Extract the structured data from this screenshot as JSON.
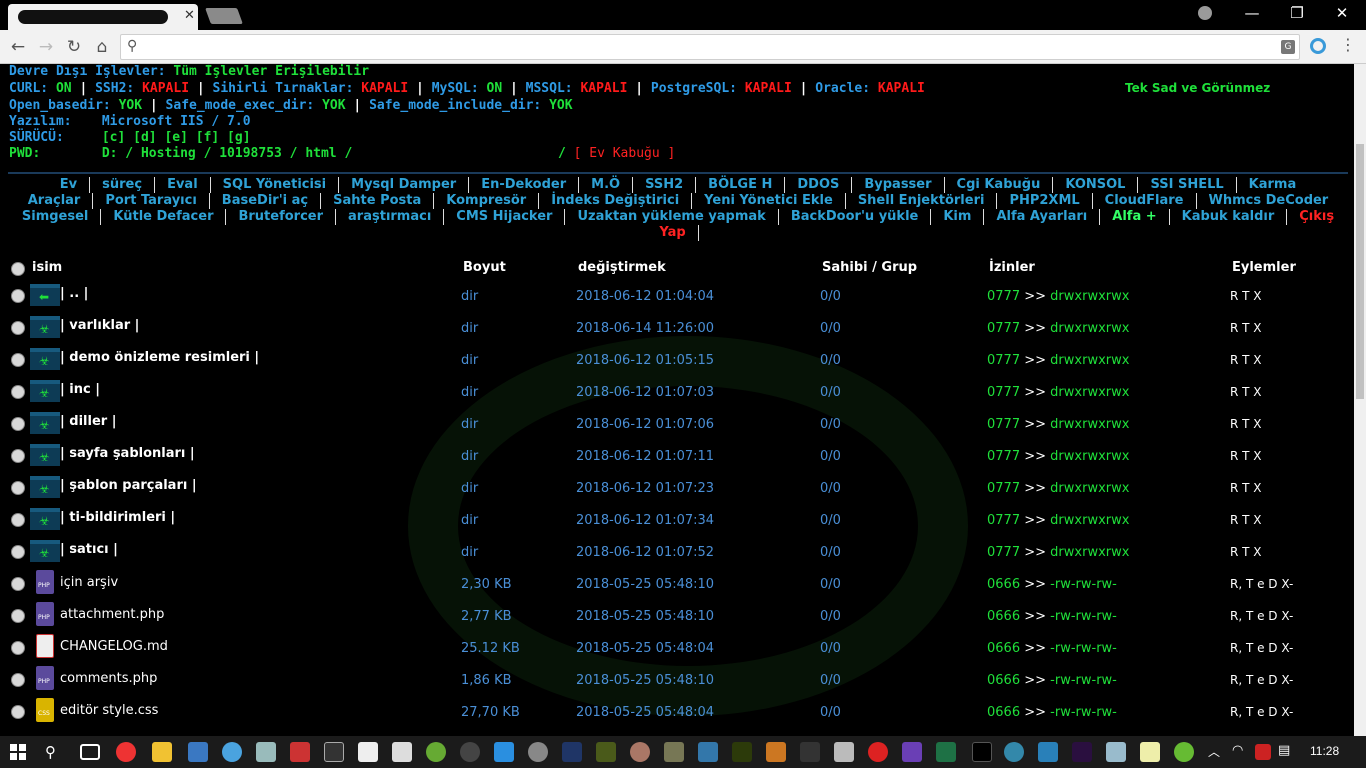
{
  "browser": {
    "tab_close": "✕",
    "window_controls": [
      "—",
      "❐",
      "✕"
    ],
    "nav": {
      "back": "←",
      "forward": "→",
      "reload": "↻",
      "home": "⌂"
    },
    "search_icon": "⚲",
    "translate_icon": "G",
    "menu": "⋮"
  },
  "info": {
    "disabled_label": "Devre Dışı İşlevler:",
    "disabled_value": "Tüm İşlevler Erişilebilir",
    "curl_label": "CURL:",
    "curl_value": "ON",
    "ssh2_label": "SSH2:",
    "ssh2_value": "KAPALI",
    "magic_label": "Sihirli Tırnaklar:",
    "magic_value": "KAPALI",
    "mysql_label": "MySQL:",
    "mysql_value": "ON",
    "mssql_label": "MSSQL:",
    "mssql_value": "KAPALI",
    "pgsql_label": "PostgreSQL:",
    "pgsql_value": "KAPALI",
    "oracle_label": "Oracle:",
    "oracle_value": "KAPALI",
    "tagline": "Tek Sad ve Görünmez",
    "openbasedir_label": "Open_basedir:",
    "openbasedir_value": "YOK",
    "safeexec_label": "Safe_mode_exec_dir:",
    "safeexec_value": "YOK",
    "safeinclude_label": "Safe_mode_include_dir:",
    "safeinclude_value": "YOK",
    "software_label": "Yazılım:",
    "software_value": "Microsoft IIS / 7.0",
    "drive_label": "SÜRÜCÜ:",
    "drive_value": "[c] [d] [e] [f] [g]",
    "pwd_label": "PWD:",
    "pwd_value": "D: / Hosting / 10198753 / html /",
    "pwd_tail": "/",
    "home_shell": "[ Ev Kabuğu ]"
  },
  "menu": {
    "row1": [
      "Ev",
      "süreç",
      "Eval",
      "SQL Yöneticisi",
      "Mysql Damper",
      "En-Dekoder",
      "M.Ö",
      "SSH2",
      "BÖLGE H",
      "DDOS",
      "Bypasser",
      "Cgi Kabuğu",
      "KONSOL",
      "SSI SHELL",
      "Karma"
    ],
    "row2": [
      "Araçlar",
      "Port Tarayıcı",
      "BaseDir'i aç",
      "Sahte Posta",
      "Kompresör",
      "İndeks Değiştirici",
      "Yeni Yönetici Ekle",
      "Shell Enjektörleri",
      "PHP2XML",
      "CloudFlare",
      "Whmcs DeCoder"
    ],
    "row3": [
      "Simgesel",
      "Kütle Defacer",
      "Bruteforcer",
      "araştırmacı",
      "CMS Hijacker",
      "Uzaktan yükleme yapmak",
      "BackDoor'u yükle",
      "Kim",
      "Alfa Ayarları",
      "Alfa +",
      "Kabuk kaldır",
      "Çıkış"
    ],
    "row4": [
      "Yap"
    ]
  },
  "table": {
    "headers": {
      "name": "isim",
      "size": "Boyut",
      "modified": "değiştirmek",
      "owner": "Sahibi / Grup",
      "perms": "İzinler",
      "actions": "Eylemler"
    },
    "rows": [
      {
        "type": "up",
        "name": "| .. |",
        "size": "dir",
        "date": "2018-06-12 01:04:04",
        "owner": "0/0",
        "perm_num": "0777",
        "perm_str": "drwxrwxrwx",
        "actions": "R T X"
      },
      {
        "type": "dir",
        "name": "| varlıklar |",
        "size": "dir",
        "date": "2018-06-14 11:26:00",
        "owner": "0/0",
        "perm_num": "0777",
        "perm_str": "drwxrwxrwx",
        "actions": "R T X"
      },
      {
        "type": "dir",
        "name": "| demo önizleme resimleri |",
        "size": "dir",
        "date": "2018-06-12 01:05:15",
        "owner": "0/0",
        "perm_num": "0777",
        "perm_str": "drwxrwxrwx",
        "actions": "R T X"
      },
      {
        "type": "dir",
        "name": "| inc |",
        "size": "dir",
        "date": "2018-06-12 01:07:03",
        "owner": "0/0",
        "perm_num": "0777",
        "perm_str": "drwxrwxrwx",
        "actions": "R T X"
      },
      {
        "type": "dir",
        "name": "| diller |",
        "size": "dir",
        "date": "2018-06-12 01:07:06",
        "owner": "0/0",
        "perm_num": "0777",
        "perm_str": "drwxrwxrwx",
        "actions": "R T X"
      },
      {
        "type": "dir",
        "name": "| sayfa şablonları |",
        "size": "dir",
        "date": "2018-06-12 01:07:11",
        "owner": "0/0",
        "perm_num": "0777",
        "perm_str": "drwxrwxrwx",
        "actions": "R T X"
      },
      {
        "type": "dir",
        "name": "| şablon parçaları |",
        "size": "dir",
        "date": "2018-06-12 01:07:23",
        "owner": "0/0",
        "perm_num": "0777",
        "perm_str": "drwxrwxrwx",
        "actions": "R T X"
      },
      {
        "type": "dir",
        "name": "| ti-bildirimleri |",
        "size": "dir",
        "date": "2018-06-12 01:07:34",
        "owner": "0/0",
        "perm_num": "0777",
        "perm_str": "drwxrwxrwx",
        "actions": "R T X"
      },
      {
        "type": "dir",
        "name": "| satıcı |",
        "size": "dir",
        "date": "2018-06-12 01:07:52",
        "owner": "0/0",
        "perm_num": "0777",
        "perm_str": "drwxrwxrwx",
        "actions": "R T X"
      },
      {
        "type": "php",
        "name": "için arşiv",
        "size": "2,30 KB",
        "date": "2018-05-25 05:48:10",
        "owner": "0/0",
        "perm_num": "0666",
        "perm_str": "-rw-rw-rw-",
        "actions": "R, T e D X-"
      },
      {
        "type": "php",
        "name": "attachment.php",
        "size": "2,77 KB",
        "date": "2018-05-25 05:48:10",
        "owner": "0/0",
        "perm_num": "0666",
        "perm_str": "-rw-rw-rw-",
        "actions": "R, T e D X-"
      },
      {
        "type": "md",
        "name": "CHANGELOG.md",
        "size": "25.12 KB",
        "date": "2018-05-25 05:48:04",
        "owner": "0/0",
        "perm_num": "0666",
        "perm_str": "-rw-rw-rw-",
        "actions": "R, T e D X-"
      },
      {
        "type": "php",
        "name": "comments.php",
        "size": "1,86 KB",
        "date": "2018-05-25 05:48:10",
        "owner": "0/0",
        "perm_num": "0666",
        "perm_str": "-rw-rw-rw-",
        "actions": "R, T e D X-"
      },
      {
        "type": "css",
        "name": "editör style.css",
        "size": "27,70 KB",
        "date": "2018-05-25 05:48:04",
        "owner": "0/0",
        "perm_num": "0666",
        "perm_str": "-rw-rw-rw-",
        "actions": "R, T e D X-"
      }
    ],
    "perm_arrow": ">>"
  },
  "taskbar": {
    "clock": "11:28"
  },
  "colors": {
    "label": "#2f9be6",
    "on": "#1fe03a",
    "off": "#ff1a1a",
    "menu": "#2fa2d6"
  }
}
